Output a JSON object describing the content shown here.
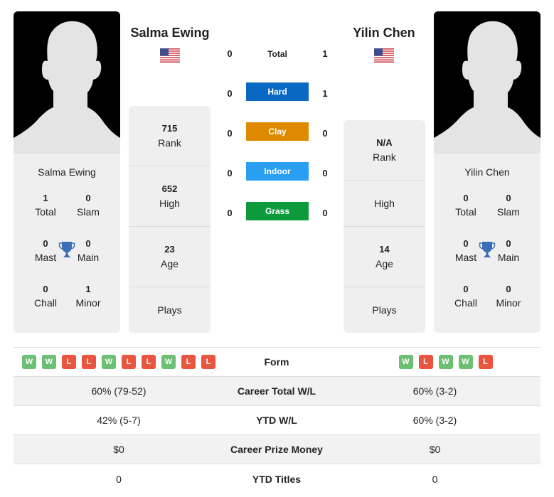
{
  "players": {
    "left": {
      "name": "Salma Ewing",
      "flag": "us-flag-icon",
      "card_name": "Salma Ewing",
      "titles": {
        "total": {
          "value": "1",
          "label": "Total"
        },
        "slam": {
          "value": "0",
          "label": "Slam"
        },
        "mast": {
          "value": "0",
          "label": "Mast"
        },
        "main": {
          "value": "0",
          "label": "Main"
        },
        "chall": {
          "value": "0",
          "label": "Chall"
        },
        "minor": {
          "value": "1",
          "label": "Minor"
        }
      },
      "stats": [
        {
          "value": "715",
          "label": "Rank"
        },
        {
          "value": "652",
          "label": "High"
        },
        {
          "value": "23",
          "label": "Age"
        },
        {
          "value": "",
          "label": "Plays"
        }
      ]
    },
    "right": {
      "name": "Yilin Chen",
      "flag": "us-flag-icon",
      "card_name": "Yilin Chen",
      "titles": {
        "total": {
          "value": "0",
          "label": "Total"
        },
        "slam": {
          "value": "0",
          "label": "Slam"
        },
        "mast": {
          "value": "0",
          "label": "Mast"
        },
        "main": {
          "value": "0",
          "label": "Main"
        },
        "chall": {
          "value": "0",
          "label": "Chall"
        },
        "minor": {
          "value": "0",
          "label": "Minor"
        }
      },
      "stats": [
        {
          "value": "N/A",
          "label": "Rank"
        },
        {
          "value": "",
          "label": "High"
        },
        {
          "value": "14",
          "label": "Age"
        },
        {
          "value": "",
          "label": "Plays"
        }
      ]
    }
  },
  "h2h": [
    {
      "label": "Total",
      "left": "0",
      "right": "1",
      "color": null
    },
    {
      "label": "Hard",
      "left": "0",
      "right": "1",
      "color": "#0868c2"
    },
    {
      "label": "Clay",
      "left": "0",
      "right": "0",
      "color": "#de8a00"
    },
    {
      "label": "Indoor",
      "left": "0",
      "right": "0",
      "color": "#2a9ff2"
    },
    {
      "label": "Grass",
      "left": "0",
      "right": "0",
      "color": "#0d9a3c"
    }
  ],
  "comparison": {
    "form_label": "Form",
    "form_left": [
      "W",
      "W",
      "L",
      "L",
      "W",
      "L",
      "L",
      "W",
      "L",
      "L"
    ],
    "form_right": [
      "W",
      "L",
      "W",
      "W",
      "L"
    ],
    "rows": [
      {
        "label": "Career Total W/L",
        "left": "60% (79-52)",
        "right": "60% (3-2)"
      },
      {
        "label": "YTD W/L",
        "left": "42% (5-7)",
        "right": "60% (3-2)"
      },
      {
        "label": "Career Prize Money",
        "left": "$0",
        "right": "$0"
      },
      {
        "label": "YTD Titles",
        "left": "0",
        "right": "0"
      }
    ]
  }
}
